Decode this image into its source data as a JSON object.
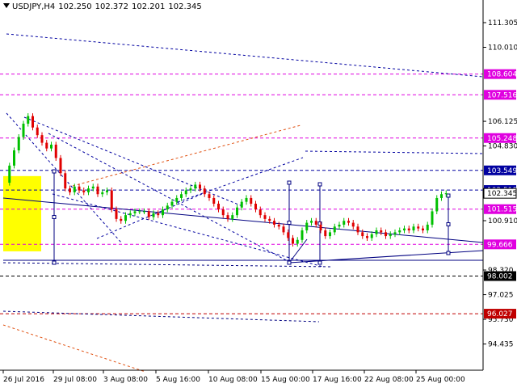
{
  "header": {
    "symbol": "USDJPY,H4",
    "open": "102.250",
    "high": "102.372",
    "low": "102.201",
    "close": "102.345"
  },
  "chart_data": {
    "type": "candlestick",
    "ylim": [
      94.2,
      112.0
    ],
    "y_ticks": [
      "111.305",
      "110.010",
      "106.125",
      "104.830",
      "100.910",
      "98.320",
      "97.025",
      "95.730",
      "94.435"
    ],
    "x_ticks": [
      "26 Jul 2016",
      "29 Jul 08:00",
      "3 Aug 08:00",
      "5 Aug 16:00",
      "10 Aug 08:00",
      "15 Aug 00:00",
      "17 Aug 16:00",
      "22 Aug 08:00",
      "25 Aug 00:00"
    ],
    "levels": [
      {
        "label": "108.604",
        "value": 108.604,
        "color": "#e000e0"
      },
      {
        "label": "107.516",
        "value": 107.516,
        "color": "#e000e0"
      },
      {
        "label": "105.248",
        "value": 105.248,
        "color": "#e000e0"
      },
      {
        "label": "103.549",
        "value": 103.549,
        "color": "#0000a0"
      },
      {
        "label": "102.519",
        "value": 102.519,
        "color": "#0000a0"
      },
      {
        "label": "101.515",
        "value": 101.515,
        "color": "#e000e0"
      },
      {
        "label": "99.666",
        "value": 99.666,
        "color": "#e000e0"
      },
      {
        "label": "98.002",
        "value": 98.002,
        "color": "#000000"
      },
      {
        "label": "96.027",
        "value": 96.027,
        "color": "#c00000"
      }
    ],
    "current_price": "102.345",
    "colors": {
      "up": "#00c000",
      "down": "#e00000",
      "highlight": "#ffff00"
    }
  }
}
